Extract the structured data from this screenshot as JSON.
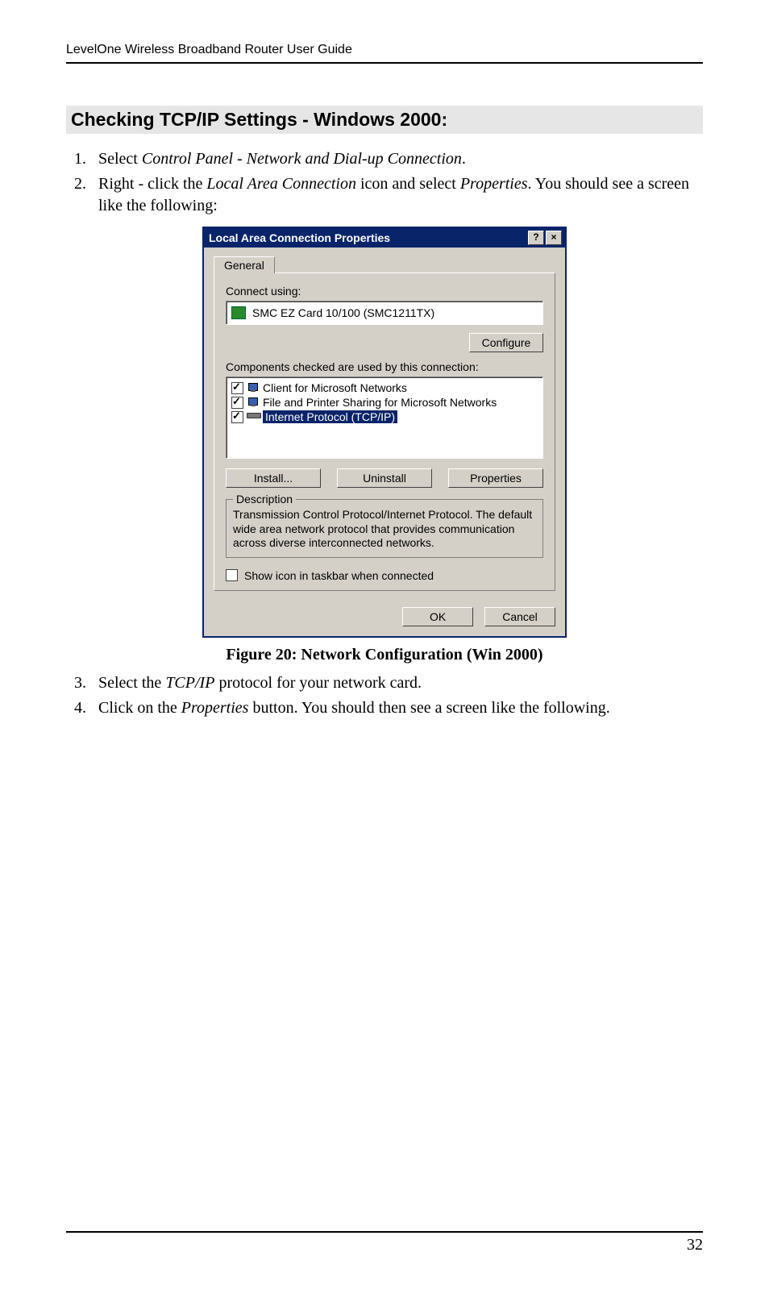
{
  "doc_header": "LevelOne Wireless Broadband Router User Guide",
  "section_heading": "Checking TCP/IP Settings - Windows 2000:",
  "steps": {
    "s1_a": "Select ",
    "s1_i": "Control Panel - Network and Dial-up Connection",
    "s1_b": ".",
    "s2_a": "Right - click the ",
    "s2_i1": "Local Area Connection",
    "s2_b": " icon and select ",
    "s2_i2": "Properties",
    "s2_c": ". You should see a screen like the following:",
    "s3_a": "Select the ",
    "s3_i": "TCP/IP",
    "s3_b": " protocol for your network card.",
    "s4_a": "Click on the ",
    "s4_i": "Properties",
    "s4_b": " button. You should then see a screen like the following."
  },
  "dialog": {
    "title": "Local Area Connection Properties",
    "help_glyph": "?",
    "close_glyph": "×",
    "tab_general": "General",
    "connect_using_label": "Connect using:",
    "adapter_name": "SMC EZ Card 10/100 (SMC1211TX)",
    "configure_btn": "Configure",
    "components_label": "Components checked are used by this connection:",
    "components": [
      {
        "label": "Client for Microsoft Networks",
        "checked": true,
        "selected": false
      },
      {
        "label": "File and Printer Sharing for Microsoft Networks",
        "checked": true,
        "selected": false
      },
      {
        "label": "Internet Protocol (TCP/IP)",
        "checked": true,
        "selected": true
      }
    ],
    "install_btn": "Install...",
    "uninstall_btn": "Uninstall",
    "properties_btn": "Properties",
    "description_legend": "Description",
    "description_text": "Transmission Control Protocol/Internet Protocol. The default wide area network protocol that provides communication across diverse interconnected networks.",
    "show_icon_label": "Show icon in taskbar when connected",
    "show_icon_checked": false,
    "ok_btn": "OK",
    "cancel_btn": "Cancel"
  },
  "figure_caption": "Figure 20: Network Configuration (Win 2000)",
  "page_number": "32"
}
